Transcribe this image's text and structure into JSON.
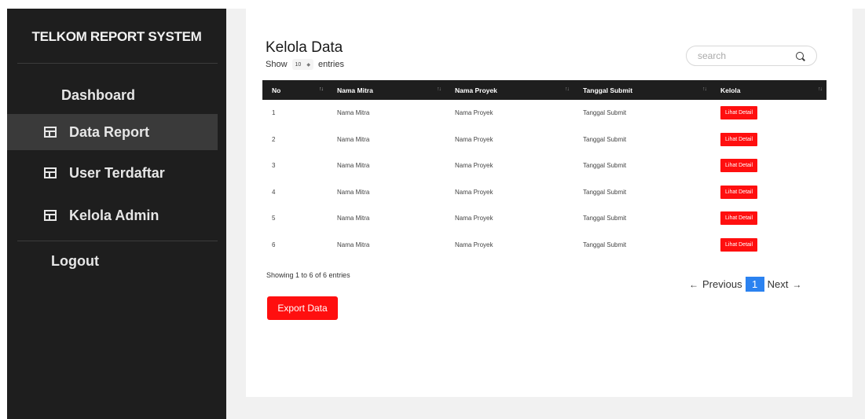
{
  "sidebar": {
    "brand": "TELKOM REPORT SYSTEM",
    "items": [
      {
        "label": "Dashboard",
        "icon": "none",
        "active": false
      },
      {
        "label": "Data Report",
        "icon": "table-icon",
        "active": true
      },
      {
        "label": "User Terdaftar",
        "icon": "table-icon",
        "active": false
      },
      {
        "label": "Kelola Admin",
        "icon": "table-icon",
        "active": false
      }
    ],
    "logout": "Logout"
  },
  "main": {
    "title": "Kelola Data",
    "show_label": "Show",
    "entries_value": "10",
    "entries_label": "entries",
    "search_placeholder": "search",
    "columns": [
      "No",
      "Nama Mitra",
      "Nama Proyek",
      "Tanggal Submit",
      "Kelola"
    ],
    "rows": [
      {
        "no": "1",
        "mitra": "Nama Mitra",
        "proyek": "Nama Proyek",
        "tanggal": "Tanggal Submit",
        "action": "Lihat Detail"
      },
      {
        "no": "2",
        "mitra": "Nama Mitra",
        "proyek": "Nama Proyek",
        "tanggal": "Tanggal Submit",
        "action": "Lihat Detail"
      },
      {
        "no": "3",
        "mitra": "Nama Mitra",
        "proyek": "Nama Proyek",
        "tanggal": "Tanggal Submit",
        "action": "Lihat Detail"
      },
      {
        "no": "4",
        "mitra": "Nama Mitra",
        "proyek": "Nama Proyek",
        "tanggal": "Tanggal Submit",
        "action": "Lihat Detail"
      },
      {
        "no": "5",
        "mitra": "Nama Mitra",
        "proyek": "Nama Proyek",
        "tanggal": "Tanggal Submit",
        "action": "Lihat Detail"
      },
      {
        "no": "6",
        "mitra": "Nama Mitra",
        "proyek": "Nama Proyek",
        "tanggal": "Tanggal Submit",
        "action": "Lihat Detail"
      }
    ],
    "info": "Showing 1 to 6 of 6 entries",
    "pagination": {
      "previous": "Previous",
      "current_page": "1",
      "next": "Next"
    },
    "export_label": "Export Data"
  },
  "colors": {
    "sidebar_bg": "#1e1e1e",
    "accent_red": "#ff0f0f",
    "page_active": "#2b82f0"
  }
}
